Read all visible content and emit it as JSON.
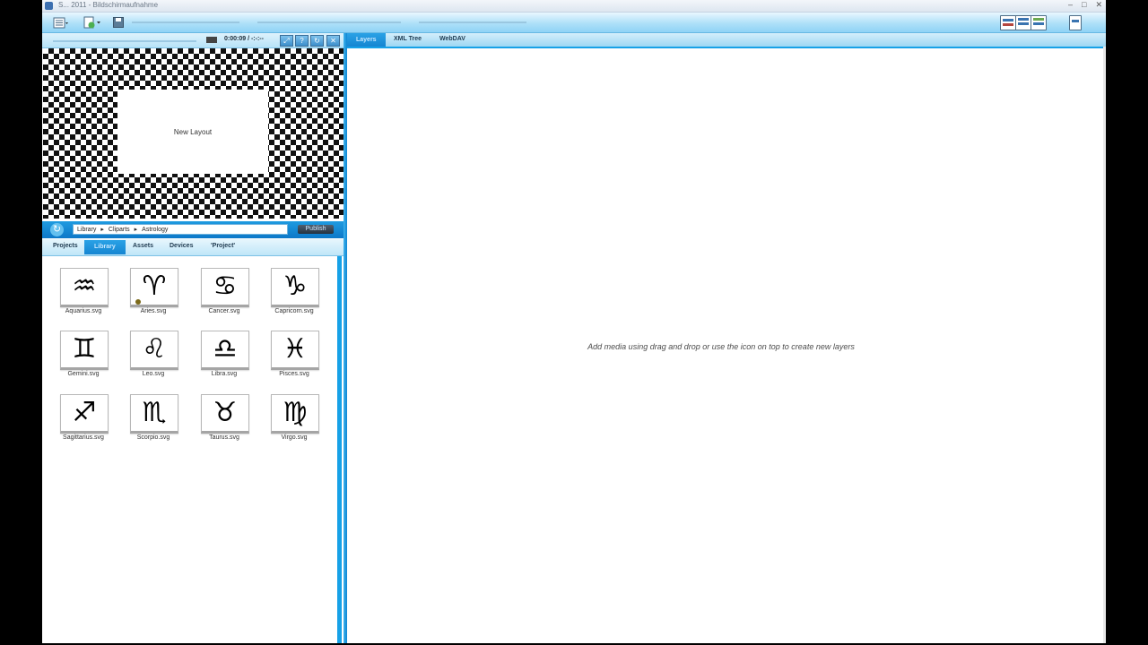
{
  "window": {
    "title": "S... 2011 - Bildschirmaufnahme",
    "controls": [
      "–",
      "□",
      "✕"
    ]
  },
  "toolbar": {
    "left_icons": [
      "menu-icon",
      "new-layer-icon",
      "save-icon"
    ],
    "right_icons": [
      "view-single-icon",
      "view-split-icon",
      "view-grid-icon",
      "device-icon"
    ]
  },
  "preview": {
    "time": "0:00:09 / -:-:--",
    "canvas_label": "New Layout",
    "buttons": [
      "⤢",
      "?",
      "↻",
      "✕"
    ]
  },
  "library": {
    "breadcrumb": [
      "Library",
      "Cliparts",
      "Astrology"
    ],
    "publish_label": "Publish",
    "tabs": [
      {
        "label": "Projects",
        "active": false
      },
      {
        "label": "Library",
        "active": true
      },
      {
        "label": "Assets",
        "active": false
      },
      {
        "label": "Devices",
        "active": false
      },
      {
        "label": "'Project'",
        "active": false
      }
    ],
    "items": [
      {
        "symbol": "♒",
        "label": "Aquarius.svg"
      },
      {
        "symbol": "♈",
        "label": "Aries.svg"
      },
      {
        "symbol": "♋",
        "label": "Cancer.svg"
      },
      {
        "symbol": "♑",
        "label": "Capricorn.svg"
      },
      {
        "symbol": "♊",
        "label": "Gemini.svg"
      },
      {
        "symbol": "♌",
        "label": "Leo.svg"
      },
      {
        "symbol": "♎",
        "label": "Libra.svg"
      },
      {
        "symbol": "♓",
        "label": "Pisces.svg"
      },
      {
        "symbol": "♐",
        "label": "Sagittarius.svg"
      },
      {
        "symbol": "♏",
        "label": "Scorpio.svg"
      },
      {
        "symbol": "♉",
        "label": "Taurus.svg"
      },
      {
        "symbol": "♍",
        "label": "Virgo.svg"
      }
    ]
  },
  "right_panel": {
    "tabs": [
      {
        "label": "Layers",
        "active": true
      },
      {
        "label": "XML Tree",
        "active": false
      },
      {
        "label": "WebDAV",
        "active": false
      }
    ],
    "empty_hint": "Add media using drag and drop or use the icon on top to create new layers"
  }
}
